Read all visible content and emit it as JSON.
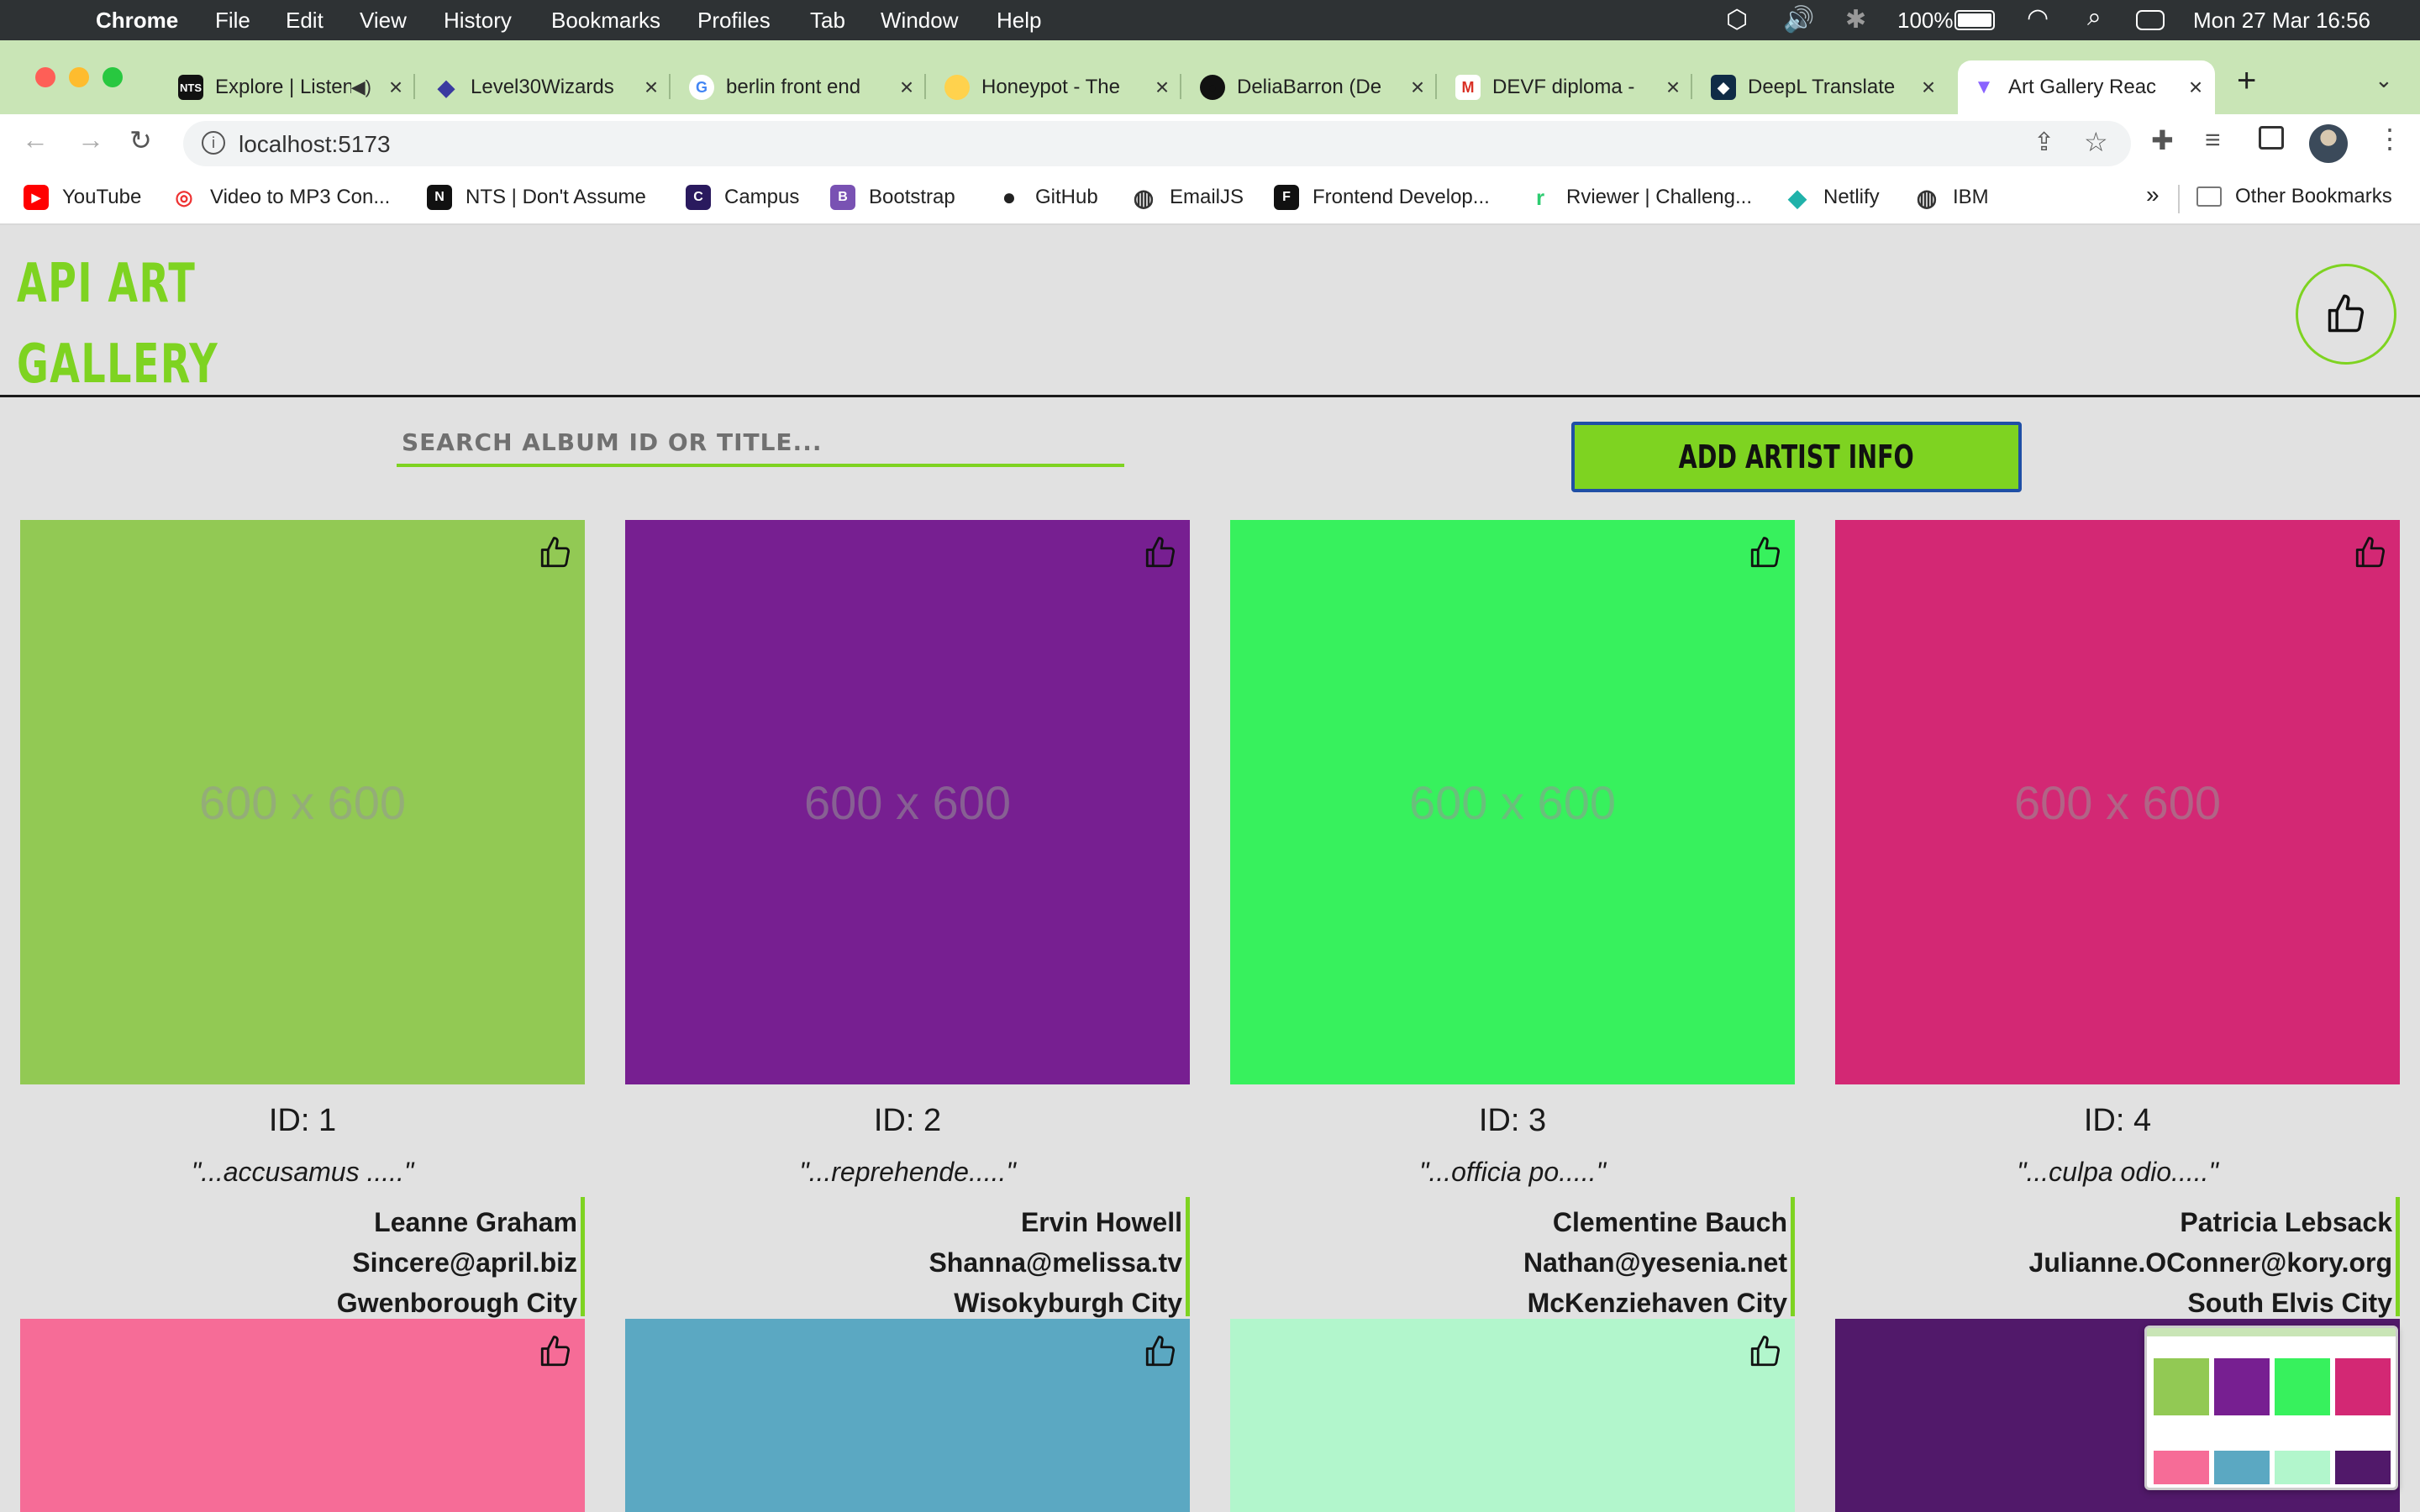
{
  "menubar": {
    "app": "Chrome",
    "items": [
      "File",
      "Edit",
      "View",
      "History",
      "Bookmarks",
      "Profiles",
      "Tab",
      "Window",
      "Help"
    ],
    "battery": "100%",
    "datetime": "Mon 27 Mar  16:56"
  },
  "tabs": [
    {
      "title": "Explore | Listen",
      "fav": "NTS",
      "color": "#111111"
    },
    {
      "title": "Level30Wizards",
      "fav": "◆",
      "color": "#3a3aa0"
    },
    {
      "title": "berlin front end",
      "fav": "G",
      "color": "#4285f4"
    },
    {
      "title": "Honeypot - The",
      "fav": "●",
      "color": "#f5b700"
    },
    {
      "title": "DeliaBarron (De",
      "fav": "●",
      "color": "#111111"
    },
    {
      "title": "DEVF diploma -",
      "fav": "M",
      "color": "#d93025"
    },
    {
      "title": "DeepL Translate",
      "fav": "◆",
      "color": "#0f2b46"
    },
    {
      "title": "Art Gallery Reac",
      "fav": "▼",
      "color": "#8a63ff",
      "active": true
    }
  ],
  "toolbar": {
    "url": "localhost:5173"
  },
  "bookmarks": [
    {
      "label": "YouTube",
      "color": "#ff0000",
      "glyph": "▶"
    },
    {
      "label": "Video to MP3 Con...",
      "color": "#e33",
      "glyph": "◎"
    },
    {
      "label": "NTS | Don't Assume",
      "color": "#111",
      "glyph": "N"
    },
    {
      "label": "Campus",
      "color": "#2a1a5e",
      "glyph": "C"
    },
    {
      "label": "Bootstrap",
      "color": "#7952b3",
      "glyph": "B"
    },
    {
      "label": "GitHub",
      "color": "#222",
      "glyph": "●"
    },
    {
      "label": "EmailJS",
      "color": "#333",
      "glyph": "◍"
    },
    {
      "label": "Frontend Develop...",
      "color": "#111",
      "glyph": "F"
    },
    {
      "label": "Rviewer | Challeng...",
      "color": "#2ecc71",
      "glyph": "r"
    },
    {
      "label": "Netlify",
      "color": "#20b2aa",
      "glyph": "◆"
    },
    {
      "label": "IBM",
      "color": "#333",
      "glyph": "◍"
    }
  ],
  "bookmarks_more": "»",
  "other_bookmarks": "Other Bookmarks",
  "app": {
    "logo_line1": "API ART",
    "logo_line2": "GALLERY",
    "search_placeholder": "SEARCH ALBUM ID OR TITLE...",
    "add_button": "ADD ARTIST INFO"
  },
  "cards": [
    {
      "color": "#92c954",
      "placeholder": "600 x 600",
      "id": "ID: 1",
      "quote": "\"...accusamus .....\"",
      "name": "Leanne Graham",
      "email": "Sincere@april.biz",
      "city": "Gwenborough City"
    },
    {
      "color": "#771f91",
      "placeholder": "600 x 600",
      "id": "ID: 2",
      "quote": "\"...reprehende.....\"",
      "name": "Ervin Howell",
      "email": "Shanna@melissa.tv",
      "city": "Wisokyburgh City"
    },
    {
      "color": "#37f15d",
      "placeholder": "600 x 600",
      "id": "ID: 3",
      "quote": "\"...officia po.....\"",
      "name": "Clementine Bauch",
      "email": "Nathan@yesenia.net",
      "city": "McKenziehaven City"
    },
    {
      "color": "#d32874",
      "placeholder": "600 x 600",
      "id": "ID: 4",
      "quote": "\"...culpa odio.....\"",
      "name": "Patricia Lebsack",
      "email": "Julianne.OConner@kory.org",
      "city": "South Elvis City"
    }
  ],
  "row2_colors": [
    "#f66c97",
    "#5ba8c2",
    "#b2f6cc",
    "#51196a"
  ]
}
